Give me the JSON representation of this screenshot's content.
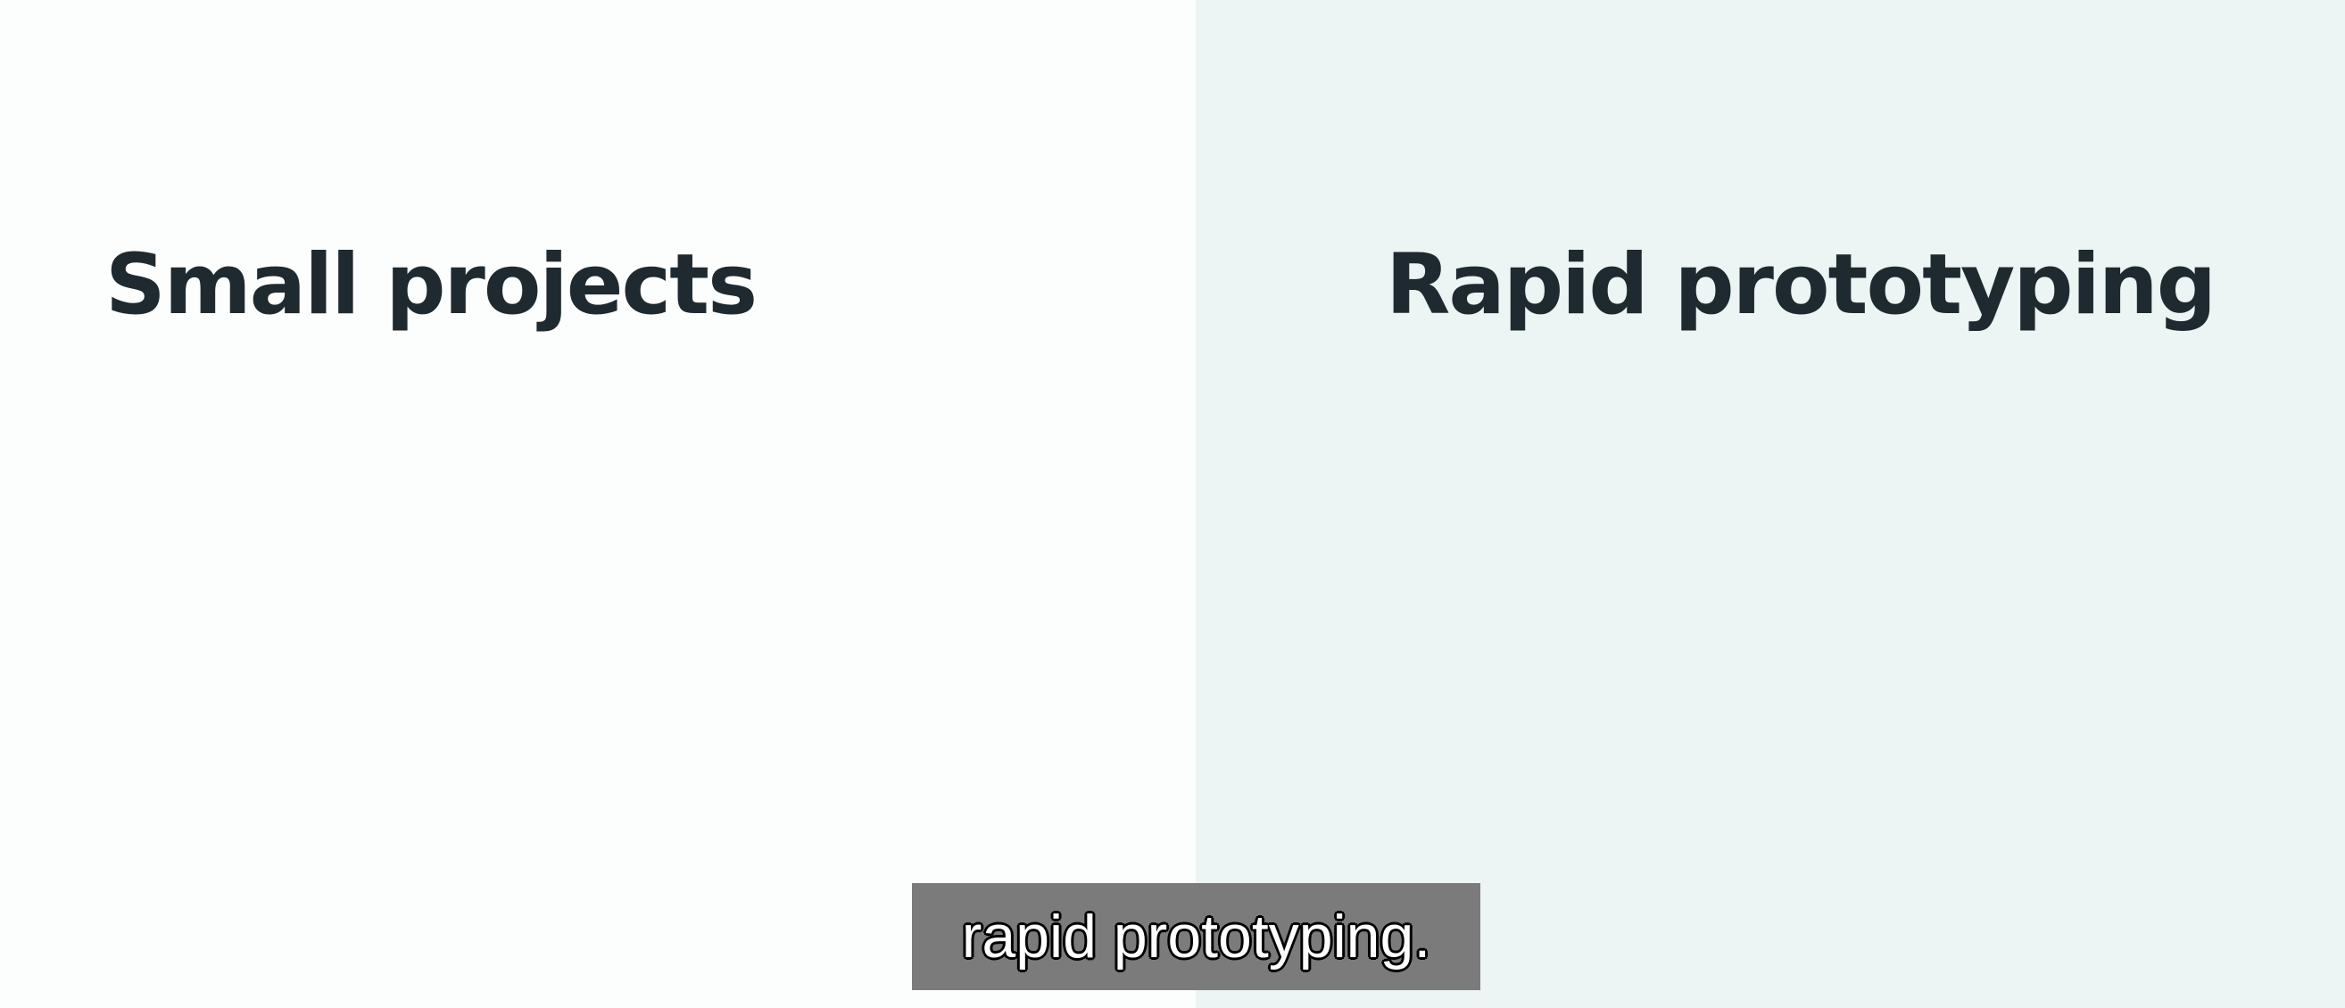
{
  "left_panel": {
    "title": "Small projects",
    "background": "#fcfdfd"
  },
  "right_panel": {
    "title": "Rapid prototyping",
    "background": "#ecf4f4"
  },
  "subtitle": {
    "text": "rapid prototyping.",
    "background": "#7b7b7b",
    "text_color": "#ffffff"
  },
  "colors": {
    "heading_text": "#1f2a30"
  }
}
